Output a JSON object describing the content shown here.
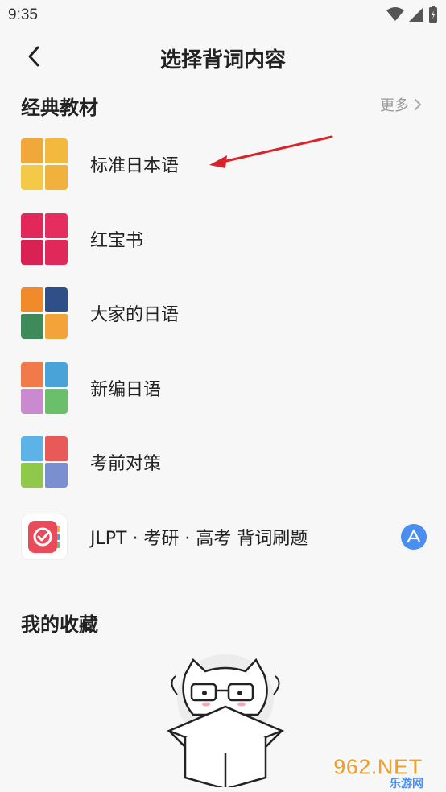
{
  "status_bar": {
    "time": "9:35"
  },
  "nav": {
    "title": "选择背词内容"
  },
  "section_classic": {
    "title": "经典教材",
    "more_label": "更多"
  },
  "books": [
    {
      "label": "标准日本语",
      "thumb_colors": [
        "#f0a83a",
        "#f3b93f",
        "#f5c948",
        "#f0b23c"
      ]
    },
    {
      "label": "红宝书",
      "thumb_colors": [
        "#e2275a",
        "#e52d5f",
        "#d92253",
        "#e0285a"
      ]
    },
    {
      "label": "大家的日语",
      "thumb_colors": [
        "#f08a2b",
        "#2e4f88",
        "#3e8a5a",
        "#f2a43a"
      ]
    },
    {
      "label": "新编日语",
      "thumb_colors": [
        "#f07a4a",
        "#4aa3d8",
        "#c98ad0",
        "#6cbf6a"
      ]
    },
    {
      "label": "考前对策",
      "thumb_colors": [
        "#5db3e6",
        "#e85a5a",
        "#8fc84a",
        "#7a8fd0"
      ]
    }
  ],
  "app_promo": {
    "label": "JLPT · 考研 · 高考 背词刷题",
    "icon": "appstore-icon",
    "accent": "#e94b5a"
  },
  "section_favorites": {
    "title": "我的收藏"
  },
  "watermark": {
    "text": "962.NET",
    "subtext": "乐游网"
  }
}
